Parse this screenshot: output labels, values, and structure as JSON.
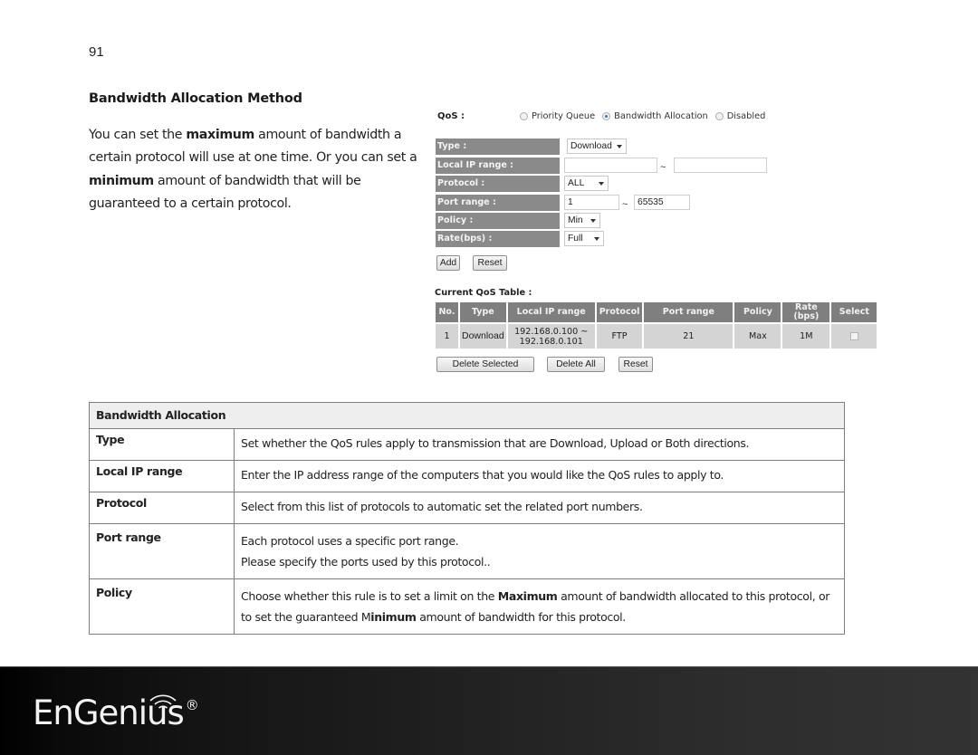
{
  "page": {
    "number": "91",
    "section_title": "Bandwidth Allocation Method",
    "intro": {
      "part1": "You can set the ",
      "bold1": "maximum",
      "part2": " amount of bandwidth a certain protocol will use at one time. Or you can set a ",
      "bold2": "minimum",
      "part3": " amount of bandwidth that will be guaranteed to a certain protocol."
    }
  },
  "qos_ui": {
    "qos_label": "QoS :",
    "modes": [
      {
        "label": "Priority Queue",
        "selected": false
      },
      {
        "label": "Bandwidth Allocation",
        "selected": true
      },
      {
        "label": "Disabled",
        "selected": false
      }
    ],
    "form": {
      "type_label": "Type :",
      "type_value": "Download",
      "local_ip_label": "Local IP range :",
      "local_ip_start": "",
      "local_ip_end": "",
      "protocol_label": "Protocol :",
      "protocol_value": "ALL",
      "port_range_label": "Port range :",
      "port_start": "1",
      "port_end": "65535",
      "policy_label": "Policy :",
      "policy_value": "Min",
      "rate_label": "Rate(bps) :",
      "rate_value": "Full",
      "range_separator": "~"
    },
    "buttons": {
      "add": "Add",
      "reset": "Reset"
    },
    "current_table": {
      "title": "Current QoS Table :",
      "headers": [
        "No.",
        "Type",
        "Local IP range",
        "Protocol",
        "Port range",
        "Policy",
        "Rate\n(bps)",
        "Select"
      ],
      "header_rate_line1": "Rate",
      "header_rate_line2": "(bps)",
      "rows": [
        {
          "no": "1",
          "type": "Download",
          "ip_start": "192.168.0.100 ~",
          "ip_end": "192.168.0.101",
          "protocol": "FTP",
          "port_range": "21",
          "policy": "Max",
          "rate": "1M",
          "selected": false
        }
      ],
      "buttons": {
        "delete_selected": "Delete Selected",
        "delete_all": "Delete All",
        "reset": "Reset"
      }
    }
  },
  "description_table": {
    "title": "Bandwidth Allocation",
    "rows": [
      {
        "key": "Type",
        "value": "Set whether the QoS rules apply to transmission that are Download, Upload or Both directions."
      },
      {
        "key": "Local IP range",
        "value": "Enter the IP address range of the computers that you would like the QoS rules to apply to."
      },
      {
        "key": "Protocol",
        "value": "Select from this list of protocols to automatic set the related port numbers."
      },
      {
        "key": "Port range",
        "line1": "Each protocol uses a specific port range.",
        "line2": "Please specify the ports used by this protocol.."
      },
      {
        "key": "Policy",
        "part1": "Choose whether this rule is to set a limit on the ",
        "bold1": "Maximum",
        "part2": " amount of bandwidth allocated to this protocol, or to set the guaranteed M",
        "bold2": "inimum",
        "part3": " amount of bandwidth for this protocol."
      }
    ]
  },
  "footer": {
    "brand": "EnGenius",
    "trademark": "®",
    "colors": {
      "background_start": "#000000",
      "background_end": "#333333",
      "logo": "#f2f2f2"
    }
  }
}
